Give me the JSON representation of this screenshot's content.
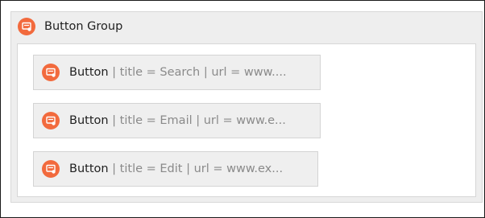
{
  "group": {
    "title": "Button Group",
    "icon": "component-icon",
    "accent_color": "#f26a3d"
  },
  "buttons": [
    {
      "type": "Button",
      "details": " | title = Search | url = www....",
      "icon": "component-icon"
    },
    {
      "type": "Button",
      "details": " | title = Email | url = www.e...",
      "icon": "component-icon"
    },
    {
      "type": "Button",
      "details": " | title = Edit | url = www.ex...",
      "icon": "component-icon"
    }
  ]
}
